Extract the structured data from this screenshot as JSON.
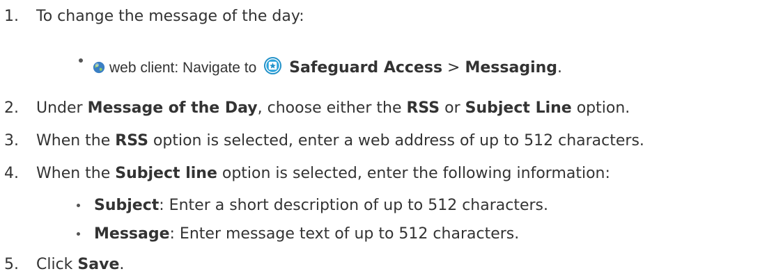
{
  "steps": [
    {
      "number": "1.",
      "text": "To change the message of the day:"
    },
    {
      "number": "2.",
      "pre": "Under ",
      "b1": "Message of the Day",
      "mid1": ", choose either the ",
      "b2": "RSS",
      "mid2": " or ",
      "b3": "Subject Line",
      "post": " option."
    },
    {
      "number": "3.",
      "pre": "When the ",
      "b1": "RSS",
      "post": " option is selected, enter a web address of up to 512 characters."
    },
    {
      "number": "4.",
      "pre": "When the ",
      "b1": "Subject line",
      "post": " option is selected, enter the following information:"
    },
    {
      "number": "5.",
      "pre": "Click ",
      "b1": "Save",
      "post": "."
    }
  ],
  "web_client": {
    "prefix": "web client: Navigate to ",
    "target": "Safeguard Access",
    "separator": " > ",
    "page": "Messaging",
    "end": ".",
    "icons": [
      "globe-icon",
      "safeguard-access-icon"
    ]
  },
  "sub_items": [
    {
      "label": "Subject",
      "text": ": Enter a short description of up to 512 characters."
    },
    {
      "label": "Message",
      "text": ": Enter message text of up to 512 characters."
    }
  ],
  "colors": {
    "text": "#333333",
    "globe_blue": "#3a7fc4",
    "icon_blue": "#1f90c8"
  }
}
